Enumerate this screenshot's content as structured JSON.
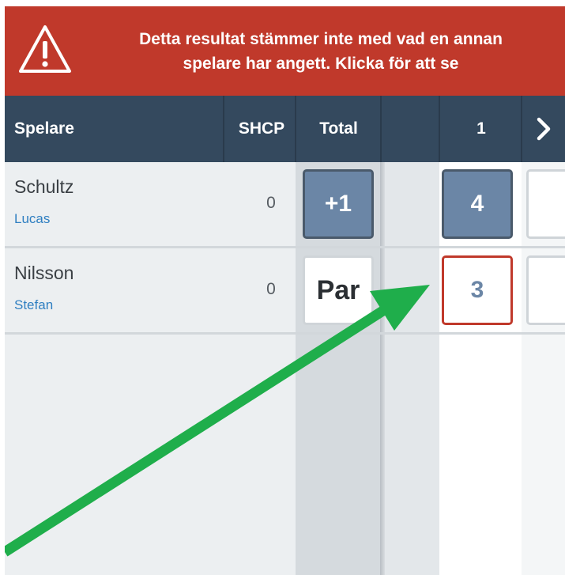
{
  "banner": {
    "message_line1": "Detta resultat stämmer inte med vad en annan",
    "message_line2": "spelare har angett. Klicka för att se",
    "icon": "warning-triangle-icon",
    "color": "#c0392b"
  },
  "header": {
    "player_label": "Spelare",
    "shcp_label": "SHCP",
    "total_label": "Total",
    "hole_number": "1",
    "next_icon": "chevron-right-icon",
    "color": "#34495e"
  },
  "players": [
    {
      "last_name": "Schultz",
      "first_name": "Lucas",
      "shcp": "0",
      "total": "+1",
      "hole1": "4"
    },
    {
      "last_name": "Nilsson",
      "first_name": "Stefan",
      "shcp": "0",
      "total": "Par",
      "hole1": "3"
    }
  ],
  "colors": {
    "accent_blue": "#2f7fc1",
    "score_filled": "#6b86a6",
    "conflict_border": "#c0392b",
    "annotation_arrow": "#1fae4b"
  }
}
